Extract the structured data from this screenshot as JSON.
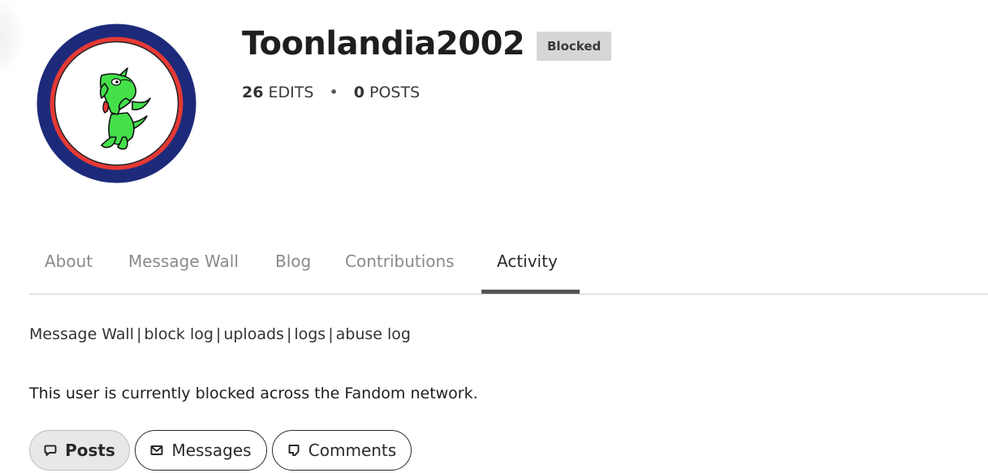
{
  "profile": {
    "username": "Toonlandia2002",
    "badge": "Blocked",
    "edits_count": "26",
    "edits_label": "EDITS",
    "posts_count": "0",
    "posts_label": "POSTS",
    "separator": "•"
  },
  "tabs": [
    {
      "label": "About",
      "active": false
    },
    {
      "label": "Message Wall",
      "active": false
    },
    {
      "label": "Blog",
      "active": false
    },
    {
      "label": "Contributions",
      "active": false
    },
    {
      "label": "Activity",
      "active": true
    }
  ],
  "links": [
    "Message Wall",
    "block log",
    "uploads",
    "logs",
    "abuse log"
  ],
  "link_separator": "|",
  "notice": "This user is currently blocked across the Fandom network.",
  "filters": [
    {
      "label": "Posts",
      "icon": "speech-bubble-icon",
      "active": true
    },
    {
      "label": "Messages",
      "icon": "envelope-icon",
      "active": false
    },
    {
      "label": "Comments",
      "icon": "comment-icon",
      "active": false
    }
  ],
  "colors": {
    "avatar_ring_outer": "#1d2a7a",
    "avatar_ring_inner": "#e53935",
    "mascot_green": "#44e04a",
    "badge_bg": "#d6d6d6",
    "active_tab_underline": "#555555"
  }
}
